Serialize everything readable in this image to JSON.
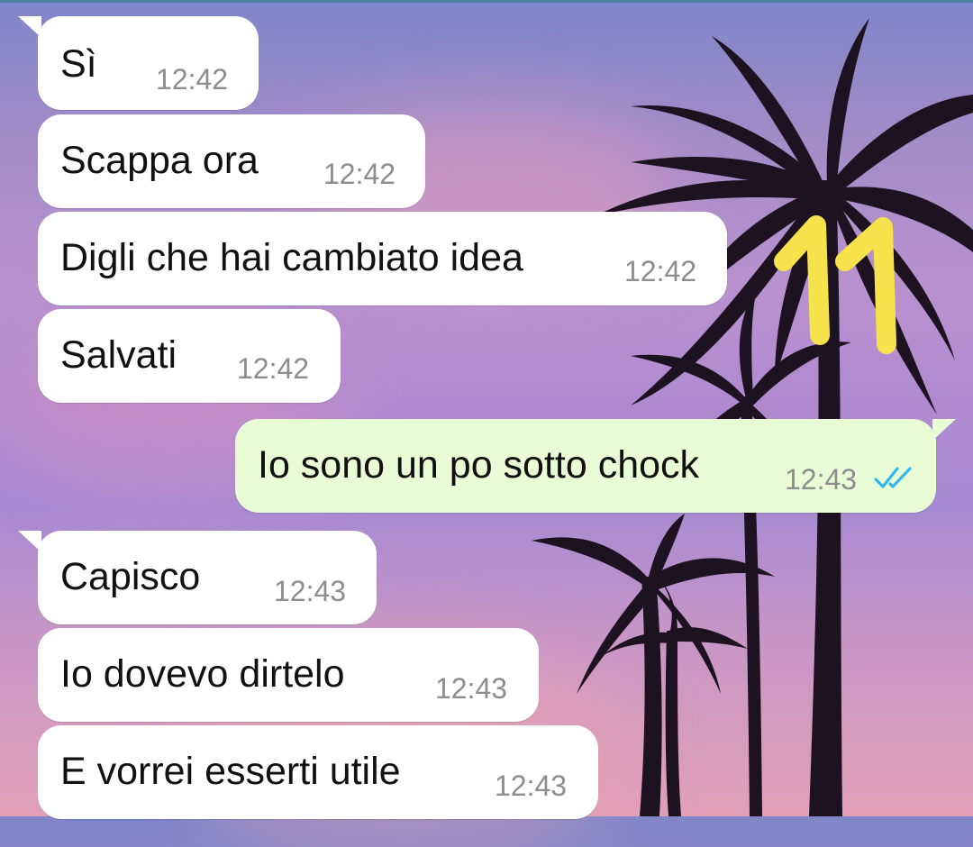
{
  "chat": {
    "messages": [
      {
        "text": "Sì",
        "time": "12:42",
        "direction": "incoming"
      },
      {
        "text": "Scappa ora",
        "time": "12:42",
        "direction": "incoming"
      },
      {
        "text": "Digli che hai cambiato idea",
        "time": "12:42",
        "direction": "incoming"
      },
      {
        "text": "Salvati",
        "time": "12:42",
        "direction": "incoming"
      },
      {
        "text": "Io sono un po sotto chock",
        "time": "12:43",
        "direction": "outgoing",
        "status": "read"
      },
      {
        "text": "Capisco",
        "time": "12:43",
        "direction": "incoming"
      },
      {
        "text": "Io dovevo dirtelo",
        "time": "12:43",
        "direction": "incoming"
      },
      {
        "text": "E vorrei esserti utile",
        "time": "12:43",
        "direction": "incoming"
      }
    ],
    "annotation": "11"
  },
  "colors": {
    "incoming_bubble": "#ffffff",
    "outgoing_bubble": "#e8fdd6",
    "read_ticks": "#34b7f1",
    "annotation": "#f6e24a"
  },
  "icons": {
    "read_status": "double-check-icon"
  }
}
